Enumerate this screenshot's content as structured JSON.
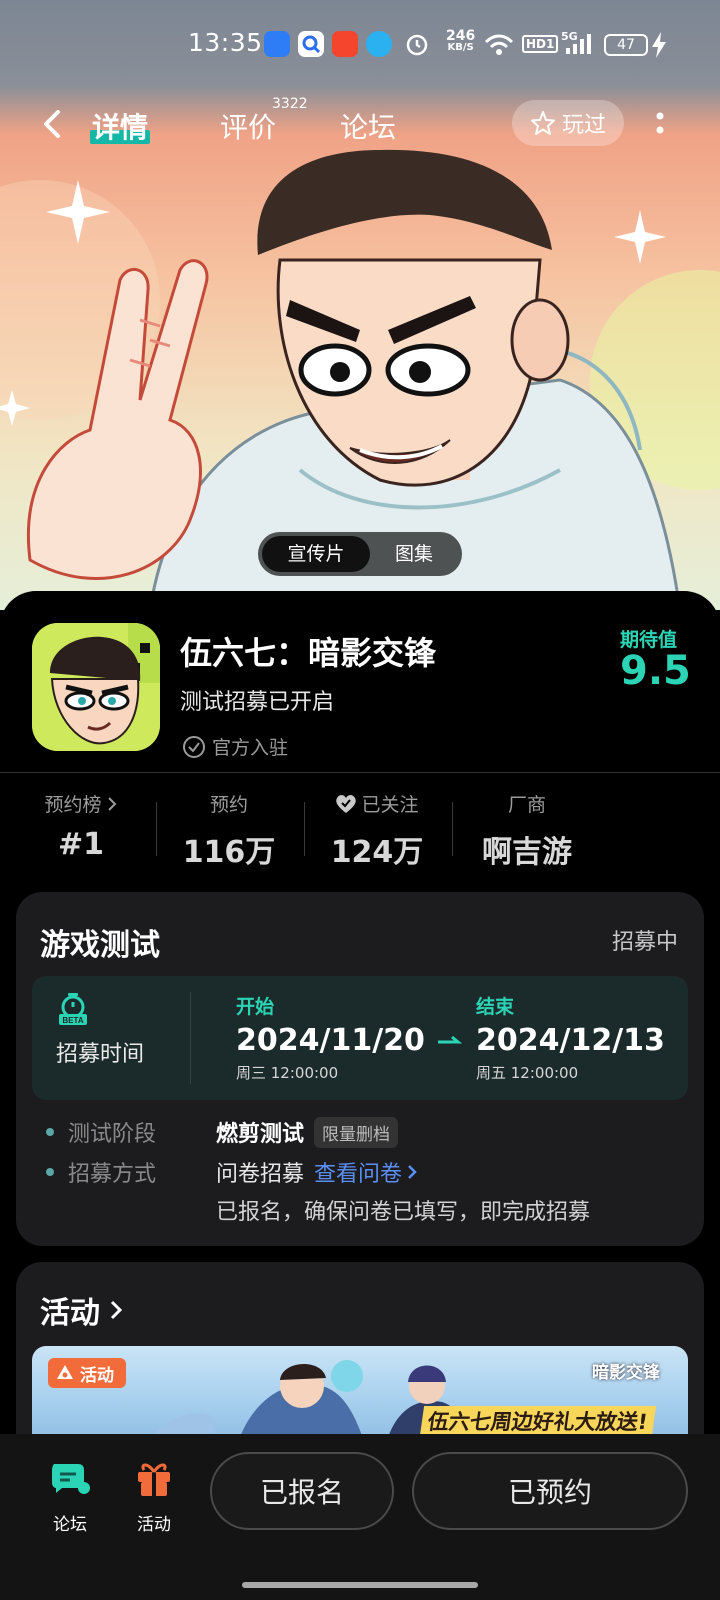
{
  "status_bar": {
    "time": "13:35",
    "net_speed_value": "246",
    "net_speed_unit": "KB/S",
    "hd_label": "HD1",
    "signal_label": "5G",
    "battery": "47",
    "icons": [
      "app-icon",
      "search-app-icon",
      "video-app-icon",
      "browser-app-icon",
      "alarm-icon",
      "wifi-icon",
      "signal-icon",
      "charging-icon"
    ]
  },
  "nav": {
    "tabs": [
      {
        "label": "详情",
        "active": true
      },
      {
        "label": "评价",
        "count": "3322"
      },
      {
        "label": "论坛"
      }
    ],
    "played_label": "玩过"
  },
  "media": {
    "options": [
      "宣传片",
      "图集"
    ],
    "selected": "宣传片"
  },
  "game": {
    "title": "伍六七：暗影交锋",
    "subtitle": "测试招募已开启",
    "official": "官方入驻",
    "expect_label": "期待值",
    "expect_value": "9.5"
  },
  "stats": [
    {
      "label": "预约榜",
      "value": "#1"
    },
    {
      "label": "预约",
      "value": "116万"
    },
    {
      "label": "已关注",
      "value": "124万"
    },
    {
      "label": "厂商",
      "value": "啊吉游"
    }
  ],
  "test": {
    "title": "游戏测试",
    "status": "招募中",
    "recruit_label": "招募时间",
    "start_label": "开始",
    "start_date": "2024/11/20",
    "start_sub": "周三  12:00:00",
    "end_label": "结束",
    "end_date": "2024/12/13",
    "end_sub": "周五  12:00:00",
    "stage_label": "测试阶段",
    "stage_value": "燃剪测试",
    "stage_tag": "限量删档",
    "method_label": "招募方式",
    "method_value": "问卷招募",
    "method_link": "查看问卷",
    "method_note": "已报名，确保问卷已填写，即完成招募"
  },
  "activity": {
    "title": "活动",
    "badge": "活动",
    "banner_promo": "伍六七周边好礼大放送!",
    "banner_logo": "暗影交锋"
  },
  "bottom": {
    "nav": [
      {
        "label": "论坛",
        "icon": "forum-icon"
      },
      {
        "label": "活动",
        "icon": "gift-icon"
      }
    ],
    "registered_label": "已报名",
    "reserved_label": "已预约"
  },
  "colors": {
    "accent": "#2bd4b4",
    "link": "#5b8ff5",
    "activity_badge": "#f26b3a",
    "card_bg": "#1c1c1e"
  }
}
